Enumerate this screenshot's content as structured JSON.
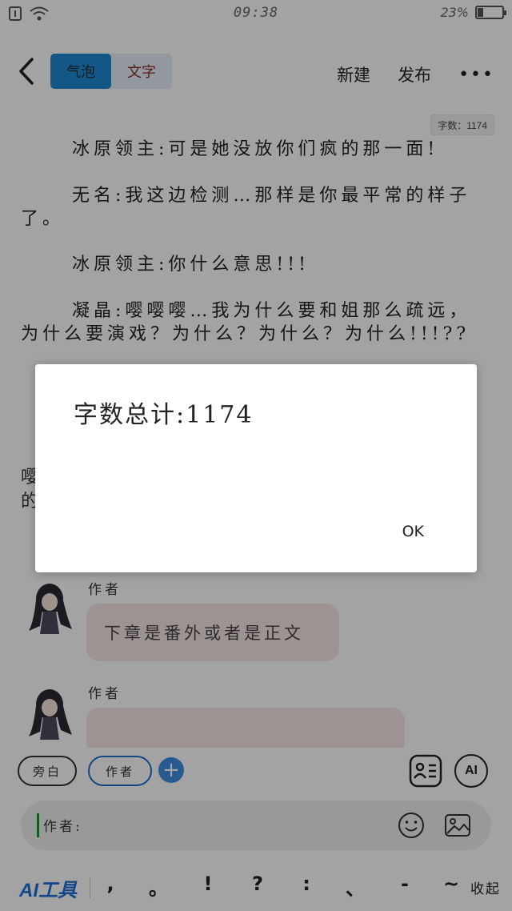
{
  "status_bar": {
    "time": "09:38",
    "battery_text": "23%",
    "battery_level": 0.23
  },
  "nav": {
    "tabs": [
      {
        "label": "气泡",
        "active": true
      },
      {
        "label": "文字",
        "active": false
      }
    ],
    "new_label": "新建",
    "publish_label": "发布",
    "more_label": "•••"
  },
  "document": {
    "word_count_badge": "字数：1174",
    "paragraphs": [
      "冰原领主:可是她没放你们疯的那一面!",
      "无名:我这边检测…那样是你最平常的样子了。",
      "冰原领主:你什么意思!!!",
      "凝晶:嘤嘤嘤…我为什么要和姐那么疏远，为什么要演戏？为什么？为什么？为什么!!!??"
    ],
    "partial_line_1": "嘤",
    "partial_line_2": "的"
  },
  "messages": [
    {
      "author": "作者",
      "text": "下章是番外或者是正文"
    },
    {
      "author": "作者",
      "text": ""
    }
  ],
  "controls": {
    "role_narrator": "旁白",
    "role_author": "作者",
    "add_label": "+",
    "ai_label": "AI",
    "input_prefix": "作者:",
    "ai_tools_label": "AI工具",
    "punctuation": [
      ",",
      "。",
      "!",
      "?",
      ":",
      "、",
      "-",
      "~"
    ],
    "collapse_label": "收起"
  },
  "dialog": {
    "message": "字数总计:1174",
    "ok_label": "OK"
  },
  "colors": {
    "accent": "#1e88d4",
    "overlay": "rgba(0,0,0,0.36)",
    "bubble": "#f7e7e7"
  }
}
